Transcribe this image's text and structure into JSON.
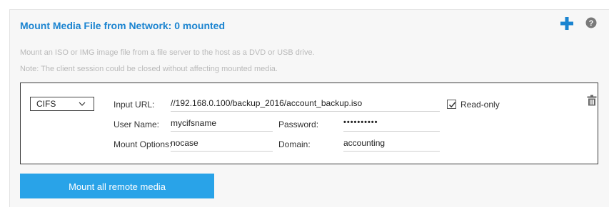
{
  "panel": {
    "title": "Mount Media File from Network: 0 mounted",
    "description_line1": "Mount an ISO or IMG image file from a file server to the host as a DVD or USB drive.",
    "description_line2": "Note: The client session could be closed without affecting mounted media.",
    "icons": {
      "add": "plus-icon",
      "help": "question-circle-icon"
    },
    "accent_color": "#1b84d0"
  },
  "media_entry": {
    "protocol": {
      "selected": "CIFS"
    },
    "input_url": {
      "label": "Input URL:",
      "value": "//192.168.0.100/backup_2016/account_backup.iso"
    },
    "read_only": {
      "label": "Read-only",
      "checked": true
    },
    "user_name": {
      "label": "User Name:",
      "value": "mycifsname"
    },
    "password": {
      "label": "Password:",
      "value": "••••••••••"
    },
    "mount_options": {
      "label": "Mount Options:",
      "value": "nocase"
    },
    "domain": {
      "label": "Domain:",
      "value": "accounting"
    },
    "delete_icon": "trash-icon"
  },
  "actions": {
    "mount_all_label": "Mount all remote media",
    "button_color": "#29a3e8"
  }
}
